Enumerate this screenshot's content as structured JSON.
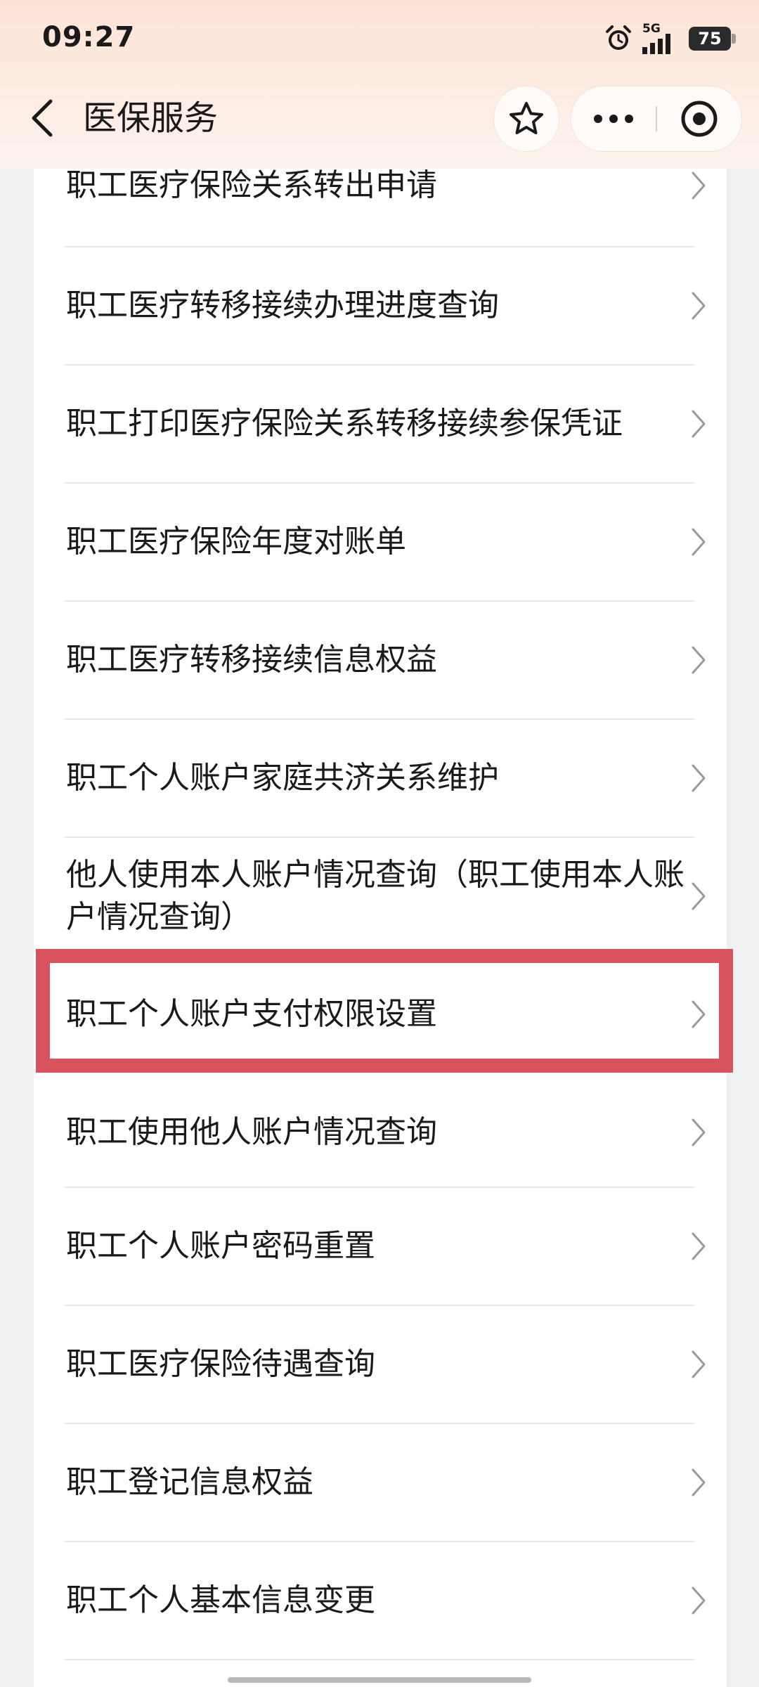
{
  "status_bar": {
    "time": "09:27",
    "network": "5G",
    "battery": "75",
    "icons": [
      "alarm-icon",
      "signal-icon",
      "battery-icon"
    ]
  },
  "header": {
    "title": "医保服务",
    "icons": [
      "back-icon",
      "star-icon",
      "more-icon",
      "close-circle-icon"
    ]
  },
  "list": {
    "items": [
      {
        "label": "职工医疗保险关系转出申请"
      },
      {
        "label": "职工医疗转移接续办理进度查询"
      },
      {
        "label": "职工打印医疗保险关系转移接续参保凭证"
      },
      {
        "label": "职工医疗保险年度对账单"
      },
      {
        "label": "职工医疗转移接续信息权益"
      },
      {
        "label": "职工个人账户家庭共济关系维护"
      },
      {
        "label": "他人使用本人账户情况查询（职工使用本人账户情况查询）"
      },
      {
        "label": "职工个人账户支付权限设置"
      },
      {
        "label": "职工使用他人账户情况查询"
      },
      {
        "label": "职工个人账户密码重置"
      },
      {
        "label": "职工医疗保险待遇查询"
      },
      {
        "label": "职工登记信息权益"
      },
      {
        "label": "职工个人基本信息变更"
      }
    ]
  },
  "colors": {
    "highlight": "#d9535e",
    "header_bg": "#fde3d6",
    "page_bg": "#eef0f1"
  }
}
